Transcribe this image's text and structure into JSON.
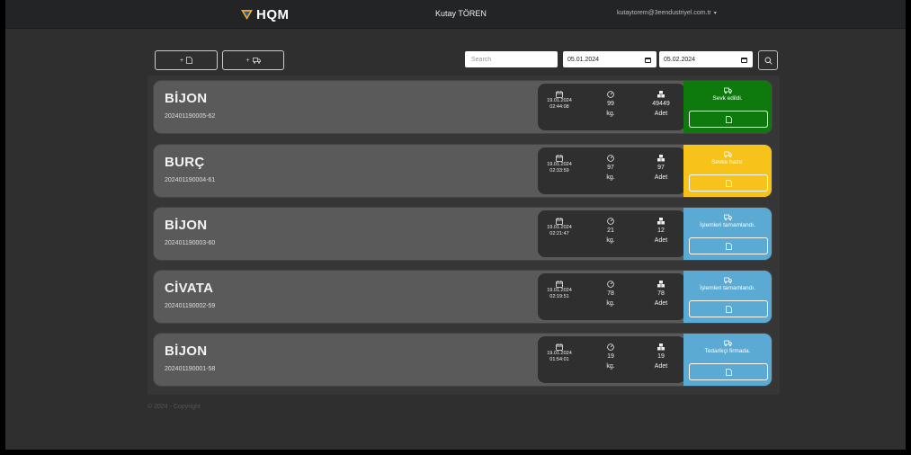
{
  "nav": {
    "brand": "HQM",
    "user_name": "Kutay TÖREN",
    "user_email": "kutaytorem@3eendustriyel.com.tr",
    "caret": "▾"
  },
  "toolbar": {
    "btn1_label": "+",
    "btn2_label": "+",
    "search_placeholder": "Search",
    "date_from": "05.01.2024",
    "date_to": "05.02.2024"
  },
  "orders": [
    {
      "title": "BİJON",
      "code": "202401190005-62",
      "date": "19.01.2024",
      "time": "02:44:08",
      "weight": "99",
      "weight_unit": "kg.",
      "qty": "49449",
      "qty_unit": "Adet",
      "status": "Sevk edildi.",
      "status_color": "#0e7a0e"
    },
    {
      "title": "BURÇ",
      "code": "202401190004-61",
      "date": "19.01.2024",
      "time": "02:33:59",
      "weight": "97",
      "weight_unit": "kg.",
      "qty": "97",
      "qty_unit": "Adet",
      "status": "Sevke hazır.",
      "status_color": "#f7c31a"
    },
    {
      "title": "BİJON",
      "code": "202401190003-60",
      "date": "19.01.2024",
      "time": "02:21:47",
      "weight": "21",
      "weight_unit": "kg.",
      "qty": "12",
      "qty_unit": "Adet",
      "status": "İşlemleri tamamlandı.",
      "status_color": "#5aaad3"
    },
    {
      "title": "CİVATA",
      "code": "202401190002-59",
      "date": "19.01.2024",
      "time": "02:19:51",
      "weight": "78",
      "weight_unit": "kg.",
      "qty": "78",
      "qty_unit": "Adet",
      "status": "İşlemleri tamamlandı.",
      "status_color": "#5aaad3"
    },
    {
      "title": "BİJON",
      "code": "202401190001-58",
      "date": "19.01.2024",
      "time": "01:54:01",
      "weight": "19",
      "weight_unit": "kg.",
      "qty": "19",
      "qty_unit": "Adet",
      "status": "Tedarikçi firmada.",
      "status_color": "#5aaad3"
    }
  ],
  "footer": {
    "text": "© 2024 - Copyright"
  }
}
